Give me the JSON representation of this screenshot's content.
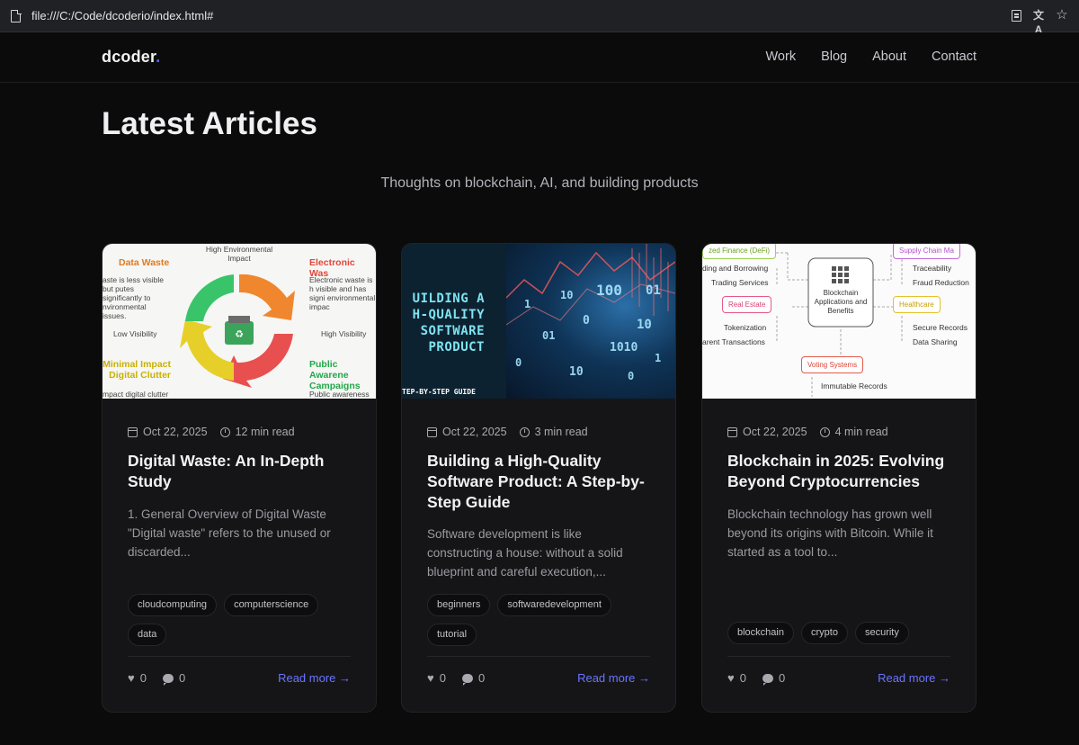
{
  "browser": {
    "url": "file:///C:/Code/dcoderio/index.html#"
  },
  "site": {
    "logo_text": "dcoder",
    "logo_dot": ".",
    "nav": [
      "Work",
      "Blog",
      "About",
      "Contact"
    ]
  },
  "page": {
    "title": "Latest Articles",
    "subtitle": "Thoughts on blockchain, AI, and building products"
  },
  "articles": [
    {
      "date": "Oct 22, 2025",
      "read_time": "12 min read",
      "title": "Digital Waste: An In-Depth Study",
      "excerpt": "1. General Overview of Digital Waste \"Digital waste\" refers to the unused or discarded...",
      "tags": [
        "cloudcomputing",
        "computerscience",
        "data"
      ],
      "likes": "0",
      "comments": "0",
      "read_more": "Read more →",
      "image": {
        "top": "High Environmental Impact",
        "tl_title": "Data Waste",
        "tl_text": "aste is less visible but putes significantly to nvironmental issues.",
        "tr_title": "Electronic Was",
        "tr_text": "Electronic waste is h visible and has signi environmental impac",
        "left": "Low Visibility",
        "right": "High Visibility",
        "bl_title": "Minimal Impact Digital Clutter",
        "bl_text": "mpact digital clutter",
        "br_title": "Public Awarene Campaigns",
        "br_text": "Public awareness ca"
      }
    },
    {
      "date": "Oct 22, 2025",
      "read_time": "3 min read",
      "title": "Building a High-Quality Software Product: A Step-by-Step Guide",
      "excerpt": "Software development is like constructing a house: without a solid blueprint and careful execution,...",
      "tags": [
        "beginners",
        "softwaredevelopment",
        "tutorial"
      ],
      "likes": "0",
      "comments": "0",
      "read_more": "Read more →",
      "image": {
        "headline": "UILDING A H-QUALITY SOFTWARE PRODUCT",
        "footer": "TEP-BY-STEP GUIDE",
        "digits": [
          "100",
          "01",
          "10",
          "1",
          "0",
          "10",
          "01",
          "1010",
          "0",
          "10",
          "0",
          "1"
        ]
      }
    },
    {
      "date": "Oct 22, 2025",
      "read_time": "4 min read",
      "title": "Blockchain in 2025: Evolving Beyond Cryptocurrencies",
      "excerpt": "Blockchain technology has grown well beyond its origins with Bitcoin. While it started as a tool to...",
      "tags": [
        "blockchain",
        "crypto",
        "security"
      ],
      "likes": "0",
      "comments": "0",
      "read_more": "Read more →",
      "image": {
        "center": "Blockchain Applications and Benefits",
        "defi": "zed Finance (DeFi)",
        "defi_1": "ding and Borrowing",
        "defi_2": "Trading Services",
        "supply": "Supply Chain Ma",
        "supply_1": "Traceability",
        "supply_2": "Fraud Reduction",
        "real_estate": "Real Estate",
        "re_1": "Tokenization",
        "re_2": "arent Transactions",
        "health": "Healthcare",
        "h_1": "Secure Records",
        "h_2": "Data Sharing",
        "voting": "Voting Systems",
        "v_1": "Immutable Records"
      }
    }
  ]
}
